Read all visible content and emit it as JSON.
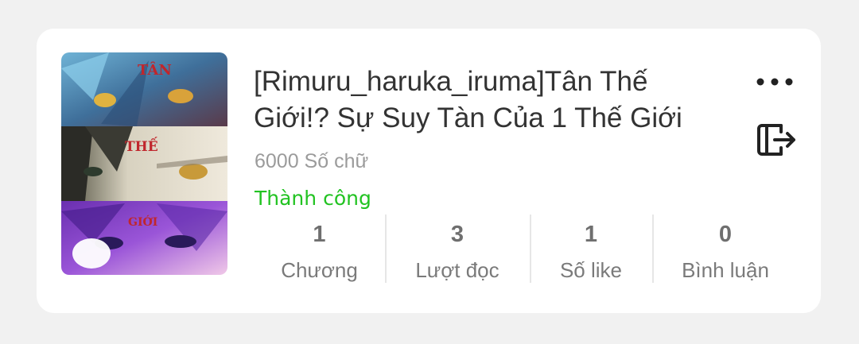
{
  "story": {
    "title": "[Rimuru_haruka_iruma]Tân Thế Giới!? Sự Suy Tàn Của 1 Thế Giới",
    "word_count": "6000 Số chữ",
    "status": "Thành công",
    "status_color": "#22c322",
    "cover": {
      "panel_texts": [
        "TÂN",
        "THẾ",
        "GIỚI"
      ]
    }
  },
  "actions": {
    "more_icon": "more-horizontal-icon",
    "exit_icon": "exit-icon"
  },
  "stats": [
    {
      "value": "1",
      "label": "Chương"
    },
    {
      "value": "3",
      "label": "Lượt đọc"
    },
    {
      "value": "1",
      "label": "Số like"
    },
    {
      "value": "0",
      "label": "Bình luận"
    }
  ]
}
